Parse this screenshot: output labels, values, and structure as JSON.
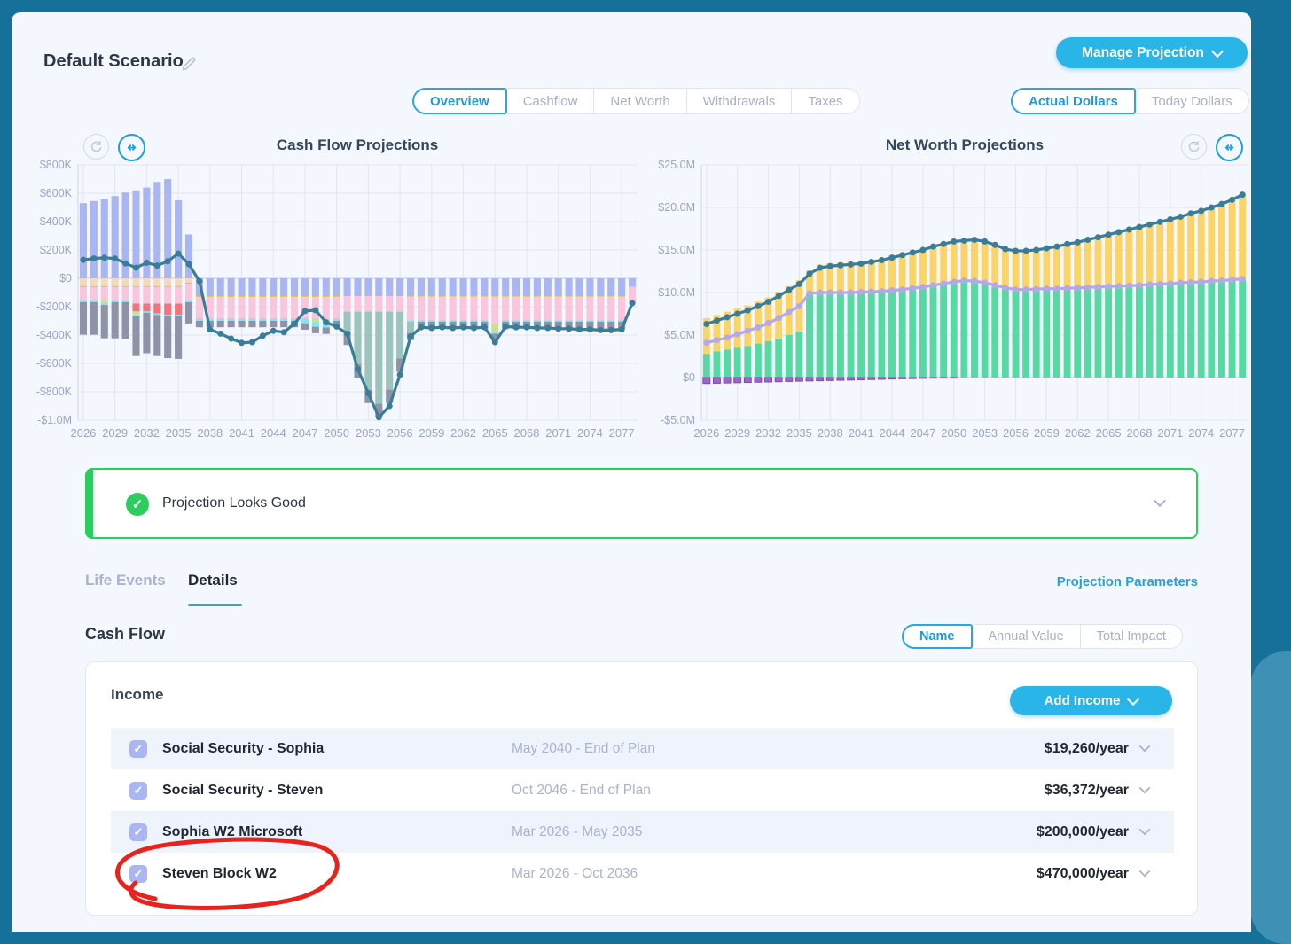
{
  "header": {
    "scenario_title": "Default Scenario",
    "manage_button": "Manage Projection"
  },
  "view_tabs": [
    "Overview",
    "Cashflow",
    "Net Worth",
    "Withdrawals",
    "Taxes"
  ],
  "active_view_tab": "Overview",
  "dollar_toggle": [
    "Actual Dollars",
    "Today Dollars"
  ],
  "active_dollar_toggle": "Actual Dollars",
  "banner": {
    "text": "Projection Looks Good"
  },
  "detail_tabs": {
    "life_events": "Life Events",
    "details": "Details",
    "active": "Details"
  },
  "projection_parameters_link": "Projection Parameters",
  "cashflow_section": {
    "heading": "Cash Flow",
    "sort_toggle": [
      "Name",
      "Annual Value",
      "Total Impact"
    ],
    "active_sort": "Name"
  },
  "income": {
    "label": "Income",
    "add_button": "Add Income",
    "rows": [
      {
        "name": "Social Security - Sophia",
        "period": "May 2040 - End of Plan",
        "value": "$19,260/year",
        "checked": true
      },
      {
        "name": "Social Security - Steven",
        "period": "Oct 2046 - End of Plan",
        "value": "$36,372/year",
        "checked": true
      },
      {
        "name": "Sophia W2 Microsoft",
        "period": "Mar 2026 - May 2035",
        "value": "$200,000/year",
        "checked": true
      },
      {
        "name": "Steven Block W2",
        "period": "Mar 2026 - Oct 2036",
        "value": "$470,000/year",
        "checked": true,
        "annotated": "red-circle"
      }
    ]
  },
  "icons": {
    "edit": "pencil-icon",
    "reset": "reset-icon",
    "expand": "horizontal-expand-icon",
    "check": "check-icon",
    "chevron": "chevron-down-icon"
  },
  "theme": {
    "frame_teal": "#15719a",
    "card_bg": "#f4f7fd",
    "accent_cyan": "#2ab5e9",
    "accent_blue": "#1f9ad6",
    "muted_text": "#a8b0c8",
    "dark_text": "#1f2733",
    "success_green": "#2dcc5e",
    "annotation_red": "#e8231d",
    "checkbox_periwinkle": "#a9b6f2"
  },
  "chart_data": [
    {
      "type": "bar",
      "subtype": "stacked-bars-with-line",
      "title": "Cash Flow Projections",
      "unit": "USD thousands",
      "ylim": [
        -1000,
        800
      ],
      "yticks": [
        800,
        600,
        400,
        200,
        0,
        -200,
        -400,
        -600,
        -800,
        -1000
      ],
      "ytick_labels": [
        "$800K",
        "$600K",
        "$400K",
        "$200K",
        "$0",
        "-$200K",
        "-$400K",
        "-$600K",
        "-$800K",
        "-$1.0M"
      ],
      "years_start": 2026,
      "years_end": 2078,
      "xtick_step": 3,
      "series": [
        {
          "name": "employment-income",
          "color": "#a9b6f2",
          "values": [
            530,
            545,
            560,
            580,
            605,
            620,
            640,
            680,
            700,
            550,
            310,
            0,
            0,
            0,
            0,
            0,
            0,
            0,
            0,
            0,
            0,
            0,
            0,
            0,
            0,
            0,
            0,
            0,
            0,
            0,
            0,
            0,
            0,
            0,
            0,
            0,
            0,
            0,
            0,
            0,
            0,
            0,
            0,
            0,
            0,
            0,
            0,
            0,
            0,
            0,
            0,
            0,
            0
          ]
        },
        {
          "name": "expenses-tan",
          "color": "#f3dabd",
          "values": [
            -55,
            -55,
            -55,
            -55,
            -55,
            -55,
            -55,
            -55,
            -55,
            -55,
            -30,
            0,
            0,
            0,
            0,
            0,
            0,
            0,
            0,
            0,
            0,
            0,
            0,
            0,
            0,
            0,
            0,
            0,
            0,
            0,
            0,
            0,
            0,
            0,
            0,
            0,
            0,
            0,
            0,
            0,
            0,
            0,
            0,
            0,
            0,
            0,
            0,
            0,
            0,
            0,
            0,
            0,
            0
          ]
        },
        {
          "name": "retirement-outflow-periwinkle",
          "color": "#a9b6f2",
          "values": [
            0,
            0,
            0,
            0,
            0,
            0,
            0,
            0,
            0,
            0,
            0,
            -125,
            -125,
            -125,
            -125,
            -125,
            -125,
            -125,
            -125,
            -125,
            -125,
            -125,
            -125,
            -125,
            -125,
            -125,
            -125,
            -125,
            -125,
            -125,
            -125,
            -125,
            -125,
            -125,
            -125,
            -125,
            -125,
            -125,
            -125,
            -125,
            -125,
            -125,
            -125,
            -125,
            -125,
            -125,
            -125,
            -125,
            -125,
            -125,
            -125,
            -125,
            -60
          ]
        },
        {
          "name": "expenses-yellow",
          "color": "#e3c93d",
          "values": [
            -8,
            -8,
            -8,
            -8,
            -8,
            -8,
            -8,
            -8,
            -8,
            -8,
            -8,
            -7,
            -7,
            -7,
            -7,
            -7,
            -7,
            -7,
            -7,
            -7,
            -7,
            -7,
            -7,
            -7,
            -7,
            0,
            0,
            0,
            0,
            0,
            0,
            -5,
            -5,
            -5,
            -5,
            -5,
            -5,
            -5,
            -5,
            -5,
            -5,
            -5,
            -5,
            -5,
            -5,
            -5,
            -5,
            -5,
            -5,
            -5,
            -5,
            -5,
            0
          ]
        },
        {
          "name": "expenses-pink",
          "color": "#f9c6de",
          "values": [
            -95,
            -95,
            -95,
            -95,
            -95,
            -115,
            -115,
            -115,
            -115,
            -115,
            -120,
            -150,
            -150,
            -150,
            -150,
            -150,
            -150,
            -150,
            -150,
            -150,
            -150,
            -150,
            -150,
            -150,
            -150,
            -110,
            -110,
            -110,
            -110,
            -110,
            -110,
            -165,
            -165,
            -165,
            -165,
            -165,
            -165,
            -165,
            -165,
            -195,
            -165,
            -165,
            -165,
            -165,
            -165,
            -165,
            -165,
            -165,
            -165,
            -165,
            -165,
            -165,
            -120
          ]
        },
        {
          "name": "expenses-red",
          "color": "#f4747e",
          "values": [
            0,
            0,
            0,
            0,
            0,
            -55,
            -55,
            -70,
            -80,
            -80,
            0,
            0,
            0,
            0,
            0,
            0,
            0,
            0,
            0,
            0,
            0,
            0,
            0,
            0,
            0,
            0,
            0,
            0,
            0,
            0,
            0,
            0,
            0,
            0,
            0,
            0,
            0,
            0,
            0,
            0,
            0,
            0,
            0,
            0,
            0,
            0,
            0,
            0,
            0,
            0,
            0,
            0,
            0
          ]
        },
        {
          "name": "expenses-green",
          "color": "#c0e495",
          "values": [
            0,
            0,
            -20,
            0,
            0,
            -25,
            0,
            0,
            0,
            0,
            0,
            0,
            0,
            0,
            0,
            0,
            0,
            0,
            0,
            0,
            0,
            0,
            -25,
            -30,
            0,
            0,
            0,
            0,
            0,
            0,
            0,
            0,
            0,
            0,
            0,
            0,
            0,
            0,
            0,
            -55,
            0,
            0,
            0,
            0,
            0,
            0,
            0,
            0,
            0,
            0,
            0,
            0,
            0
          ]
        },
        {
          "name": "expenses-cyan",
          "color": "#7ce8f4",
          "values": [
            -10,
            -10,
            -10,
            -10,
            -10,
            -10,
            -10,
            -10,
            -10,
            -10,
            -10,
            -18,
            -18,
            -18,
            -18,
            -18,
            -18,
            -18,
            -18,
            -18,
            -18,
            -35,
            -35,
            -35,
            -18,
            0,
            0,
            0,
            0,
            0,
            0,
            -10,
            -10,
            -10,
            -10,
            -10,
            -10,
            -10,
            -10,
            -10,
            -10,
            -10,
            -10,
            -10,
            -10,
            -10,
            -10,
            -10,
            -10,
            -10,
            -10,
            -10,
            0
          ]
        },
        {
          "name": "college-drawdown-sage",
          "color": "#9cc3bc",
          "values": [
            0,
            0,
            0,
            0,
            0,
            0,
            0,
            0,
            0,
            0,
            0,
            0,
            0,
            0,
            0,
            0,
            0,
            0,
            0,
            0,
            0,
            0,
            0,
            0,
            0,
            -140,
            -370,
            -550,
            -650,
            -550,
            -330,
            -80,
            0,
            0,
            0,
            0,
            0,
            0,
            0,
            0,
            0,
            0,
            0,
            0,
            0,
            0,
            0,
            0,
            0,
            0,
            0,
            0,
            0
          ]
        },
        {
          "name": "taxes-gray",
          "color": "#8e93a8",
          "values": [
            -230,
            -230,
            -235,
            -255,
            -260,
            -280,
            -285,
            -290,
            -295,
            -300,
            -150,
            -45,
            -45,
            -45,
            -45,
            -45,
            -45,
            -45,
            -45,
            -45,
            -45,
            -45,
            -45,
            -45,
            -45,
            -95,
            -95,
            -95,
            -95,
            -95,
            -95,
            -50,
            -50,
            -50,
            -50,
            -50,
            -50,
            -50,
            -50,
            -50,
            -50,
            -50,
            -50,
            -50,
            -50,
            -50,
            -50,
            -50,
            -50,
            -50,
            -50,
            -50,
            0
          ]
        }
      ],
      "lines": [
        {
          "name": "net-cash-flow",
          "color": "#3a7d98",
          "values": [
            130,
            140,
            145,
            140,
            105,
            75,
            110,
            90,
            120,
            175,
            100,
            -20,
            -360,
            -390,
            -425,
            -455,
            -450,
            -405,
            -370,
            -380,
            -320,
            -230,
            -225,
            -310,
            -340,
            -390,
            -640,
            -810,
            -980,
            -900,
            -680,
            -410,
            -345,
            -350,
            -345,
            -350,
            -345,
            -350,
            -345,
            -450,
            -340,
            -345,
            -345,
            -350,
            -350,
            -355,
            -355,
            -360,
            -360,
            -365,
            -365,
            -360,
            -175
          ]
        }
      ]
    },
    {
      "type": "bar",
      "subtype": "stacked-bars-with-lines",
      "title": "Net Worth Projections",
      "unit": "USD millions",
      "ylim": [
        -5,
        25
      ],
      "yticks": [
        25,
        20,
        15,
        10,
        5,
        0,
        -5
      ],
      "ytick_labels": [
        "$25.0M",
        "$20.0M",
        "$15.0M",
        "$10.0M",
        "$5.0M",
        "$0",
        "-$5.0M"
      ],
      "years_start": 2026,
      "years_end": 2078,
      "xtick_step": 3,
      "series": [
        {
          "name": "liquid-assets-green",
          "color": "#57d9a3",
          "values": [
            2.8,
            3.1,
            3.3,
            3.5,
            3.7,
            4.0,
            4.3,
            4.6,
            5.0,
            5.4,
            9.9,
            9.9,
            9.9,
            9.9,
            10.0,
            10.0,
            10.0,
            10.0,
            10.1,
            10.2,
            10.35,
            10.5,
            10.7,
            10.9,
            11.1,
            11.25,
            11.2,
            11.0,
            10.7,
            10.4,
            10.2,
            10.2,
            10.25,
            10.3,
            10.3,
            10.35,
            10.4,
            10.45,
            10.5,
            10.55,
            10.6,
            10.65,
            10.7,
            10.8,
            10.85,
            10.9,
            11.0,
            11.05,
            11.1,
            11.2,
            11.25,
            11.35,
            11.45
          ]
        },
        {
          "name": "tax-advantaged-yellow",
          "color": "#fbd468",
          "values": [
            4.2,
            4.27,
            4.44,
            4.61,
            4.78,
            4.95,
            5.12,
            5.49,
            5.76,
            6.03,
            2.7,
            3.38,
            3.55,
            3.62,
            3.59,
            3.66,
            3.83,
            4.0,
            4.17,
            4.34,
            4.47,
            4.59,
            4.77,
            4.85,
            4.93,
            4.85,
            5.0,
            5.0,
            4.9,
            4.7,
            4.7,
            4.7,
            4.75,
            4.9,
            5.1,
            5.35,
            5.5,
            5.75,
            6.0,
            6.25,
            6.5,
            6.75,
            7.0,
            7.2,
            7.45,
            7.7,
            7.9,
            8.25,
            8.5,
            8.8,
            9.15,
            9.55,
            10.05
          ]
        },
        {
          "name": "liabilities-purple",
          "color": "#9a67c5",
          "stroke": "#7a4ea6",
          "values": [
            -0.7,
            -0.67,
            -0.64,
            -0.61,
            -0.58,
            -0.55,
            -0.52,
            -0.49,
            -0.46,
            -0.43,
            -0.4,
            -0.38,
            -0.35,
            -0.32,
            -0.29,
            -0.26,
            -0.23,
            -0.2,
            -0.17,
            -0.14,
            -0.12,
            -0.09,
            -0.07,
            -0.05,
            -0.03,
            0,
            0,
            0,
            0,
            0,
            0,
            0,
            0,
            0,
            0,
            0,
            0,
            0,
            0,
            0,
            0,
            0,
            0,
            0,
            0,
            0,
            0,
            0,
            0,
            0,
            0,
            0,
            0
          ]
        }
      ],
      "lines": [
        {
          "name": "total-net-worth",
          "color": "#3a7d98",
          "values": [
            6.3,
            6.7,
            7.1,
            7.5,
            7.9,
            8.4,
            8.9,
            9.6,
            10.3,
            11.0,
            12.2,
            12.9,
            13.1,
            13.2,
            13.3,
            13.4,
            13.6,
            13.8,
            14.1,
            14.4,
            14.7,
            15.0,
            15.4,
            15.7,
            16.0,
            16.1,
            16.2,
            16.0,
            15.6,
            15.1,
            14.9,
            14.9,
            15.0,
            15.2,
            15.4,
            15.7,
            15.9,
            16.2,
            16.5,
            16.8,
            17.1,
            17.4,
            17.7,
            18.0,
            18.3,
            18.6,
            18.9,
            19.3,
            19.6,
            20.0,
            20.4,
            20.9,
            21.5
          ]
        },
        {
          "name": "liquid-net-worth",
          "color": "#b3a8ea",
          "values": [
            4.1,
            4.4,
            4.7,
            5.1,
            5.5,
            5.9,
            6.4,
            7.0,
            7.7,
            8.4,
            9.9,
            10.0,
            10.0,
            10.0,
            10.0,
            10.05,
            10.1,
            10.15,
            10.25,
            10.35,
            10.5,
            10.65,
            10.85,
            11.05,
            11.25,
            11.4,
            11.35,
            11.15,
            10.85,
            10.55,
            10.35,
            10.35,
            10.4,
            10.45,
            10.45,
            10.5,
            10.55,
            10.6,
            10.65,
            10.7,
            10.75,
            10.8,
            10.85,
            10.95,
            11.0,
            11.05,
            11.15,
            11.2,
            11.25,
            11.35,
            11.4,
            11.5,
            11.6
          ]
        }
      ]
    }
  ]
}
